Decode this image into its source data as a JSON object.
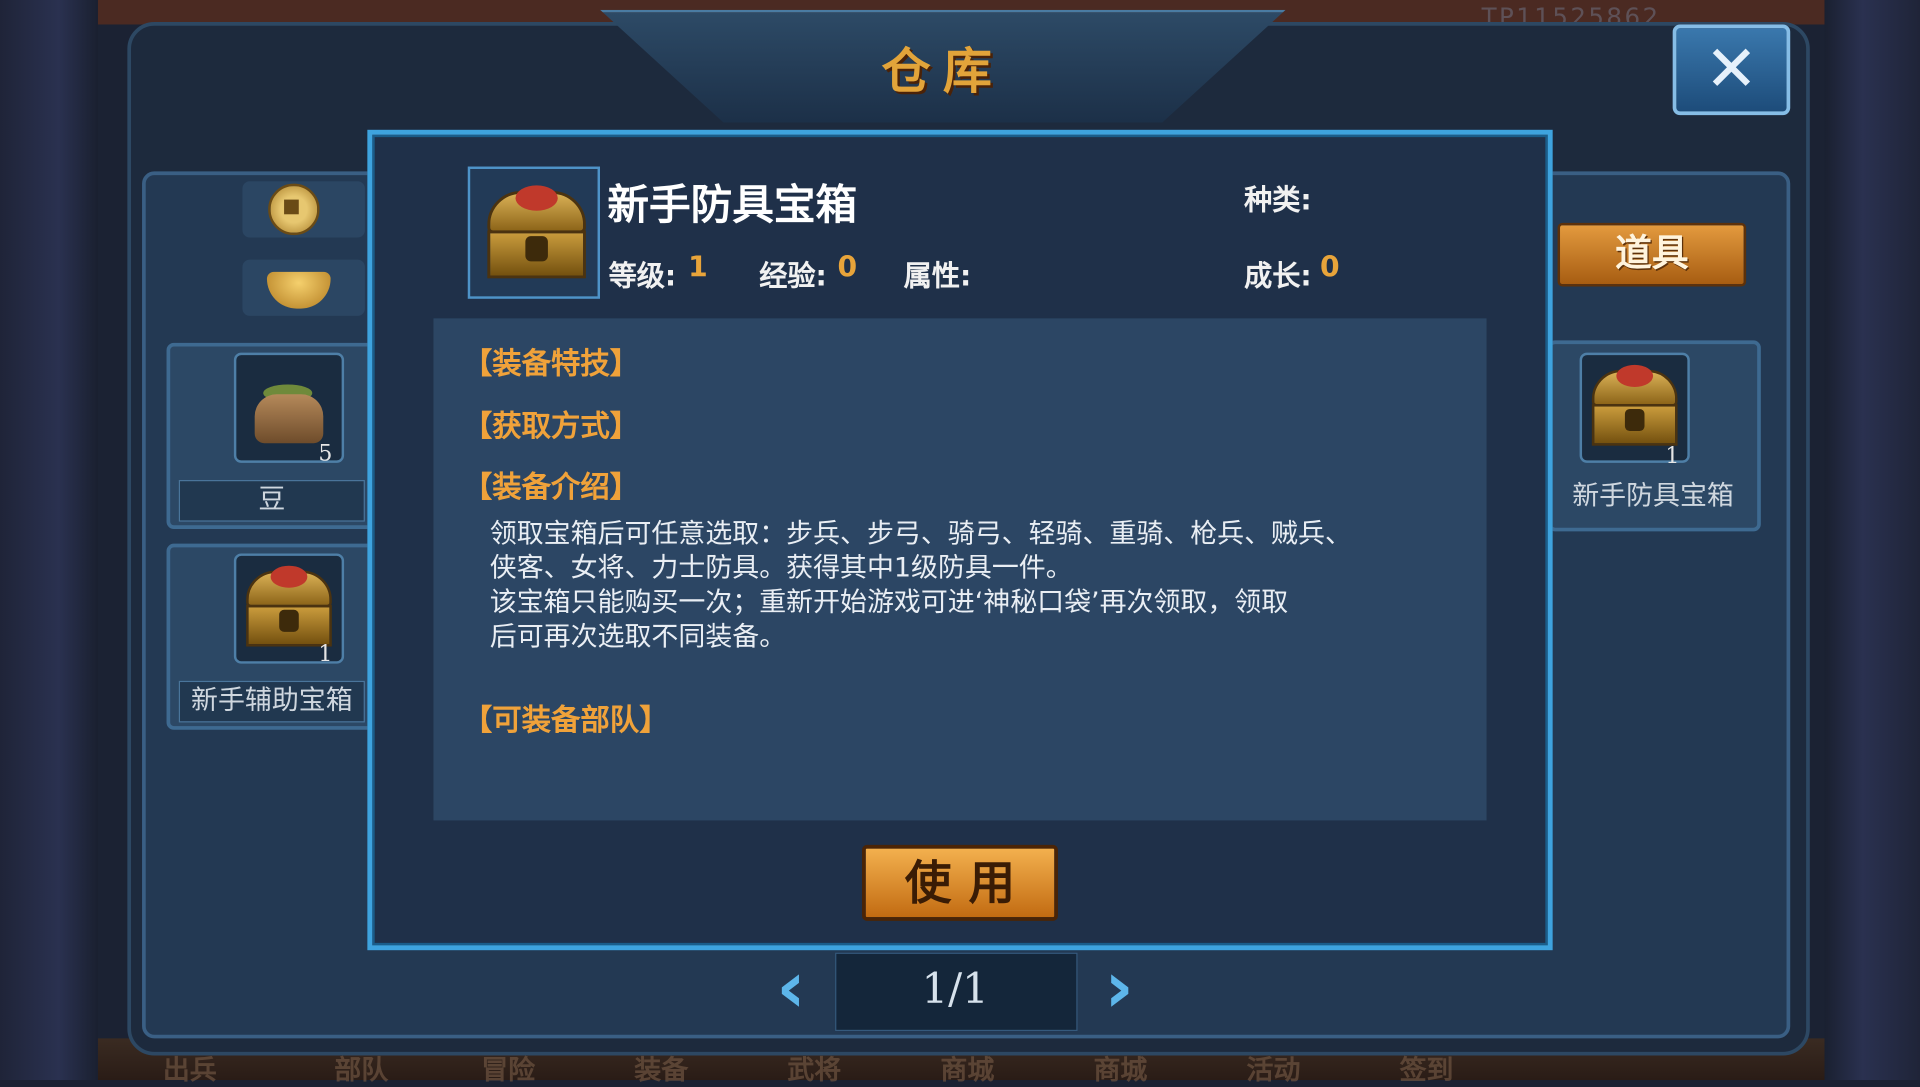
{
  "window": {
    "title": "仓库",
    "close_label": "✕"
  },
  "background": {
    "corner_id": "TP11525862",
    "bottom_tabs": [
      "出兵",
      "部队",
      "冒险",
      "装备",
      "武将",
      "商城",
      "商城",
      "活动",
      "签到"
    ]
  },
  "currencies": [
    {
      "icon": "copper-coin-icon"
    },
    {
      "icon": "gold-ingot-icon"
    }
  ],
  "inventory": {
    "tab_label": "道具",
    "items": [
      {
        "name": "豆",
        "count": "5",
        "icon": "bean-sack-icon"
      },
      {
        "name": "新手辅助宝箱",
        "count": "1",
        "icon": "treasure-chest-icon"
      },
      {
        "name": "新手防具宝箱",
        "count": "1",
        "icon": "treasure-chest-icon"
      }
    ]
  },
  "detail": {
    "item_name": "新手防具宝箱",
    "type_label": "种类:",
    "level_label": "等级:",
    "level_value": "1",
    "exp_label": "经验:",
    "exp_value": "0",
    "attr_label": "属性:",
    "growth_label": "成长:",
    "growth_value": "0",
    "sections": {
      "skills": "【装备特技】",
      "obtain": "【获取方式】",
      "intro": "【装备介绍】",
      "troops": "【可装备部队】"
    },
    "description_lines": [
      "领取宝箱后可任意选取：步兵、步弓、骑弓、轻骑、重骑、枪兵、贼兵、",
      "侠客、女将、力士防具。获得其中1级防具一件。",
      "该宝箱只能购买一次；重新开始游戏可进‘神秘口袋’再次领取，领取",
      "后可再次选取不同装备。"
    ],
    "use_button": "使用"
  },
  "pager": {
    "text": "1/1",
    "prev": "‹",
    "next": "›"
  }
}
